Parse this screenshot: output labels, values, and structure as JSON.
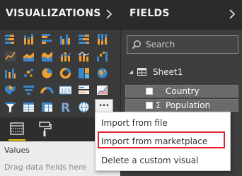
{
  "visualizations": {
    "title": "VISUALIZATIONS",
    "icons": [
      "stacked-bar-chart-icon",
      "stacked-column-chart-icon",
      "clustered-bar-chart-icon",
      "clustered-column-chart-icon",
      "100-stacked-bar-chart-icon",
      "100-stacked-column-chart-icon",
      "line-chart-icon",
      "area-chart-icon",
      "stacked-area-chart-icon",
      "line-clustered-column-chart-icon",
      "line-stacked-column-chart-icon",
      "waterfall-chart-icon",
      "ribbon-chart-icon",
      "scatter-chart-icon",
      "pie-chart-icon",
      "donut-chart-icon",
      "treemap-icon",
      "map-icon",
      "filled-map-icon",
      "funnel-icon",
      "gauge-icon",
      "card-icon",
      "multi-row-card-icon",
      "kpi-icon",
      "slicer-icon",
      "table-icon",
      "matrix-icon",
      "r-script-visual-icon",
      "globe-icon"
    ],
    "more_label": "...",
    "build_tabs": [
      "fields-tab-icon",
      "format-paint-roller-icon"
    ],
    "values_label": "Values",
    "drop_hint": "Drag data fields here"
  },
  "fields": {
    "title": "FIELDS",
    "search_placeholder": "Search",
    "table": {
      "name": "Sheet1",
      "fields": [
        {
          "label": "Country",
          "sigma": ""
        },
        {
          "label": "Population",
          "sigma": "Σ"
        }
      ]
    }
  },
  "context_menu": {
    "items": [
      "Import from file",
      "Import from marketplace",
      "Delete a custom visual"
    ],
    "highlight_color": "#e3202b"
  },
  "colors": {
    "accent": "#f2c811",
    "panel_dark": "#2b2b2b",
    "icon_orange": "#f0a030",
    "icon_blue": "#3a86c8"
  }
}
